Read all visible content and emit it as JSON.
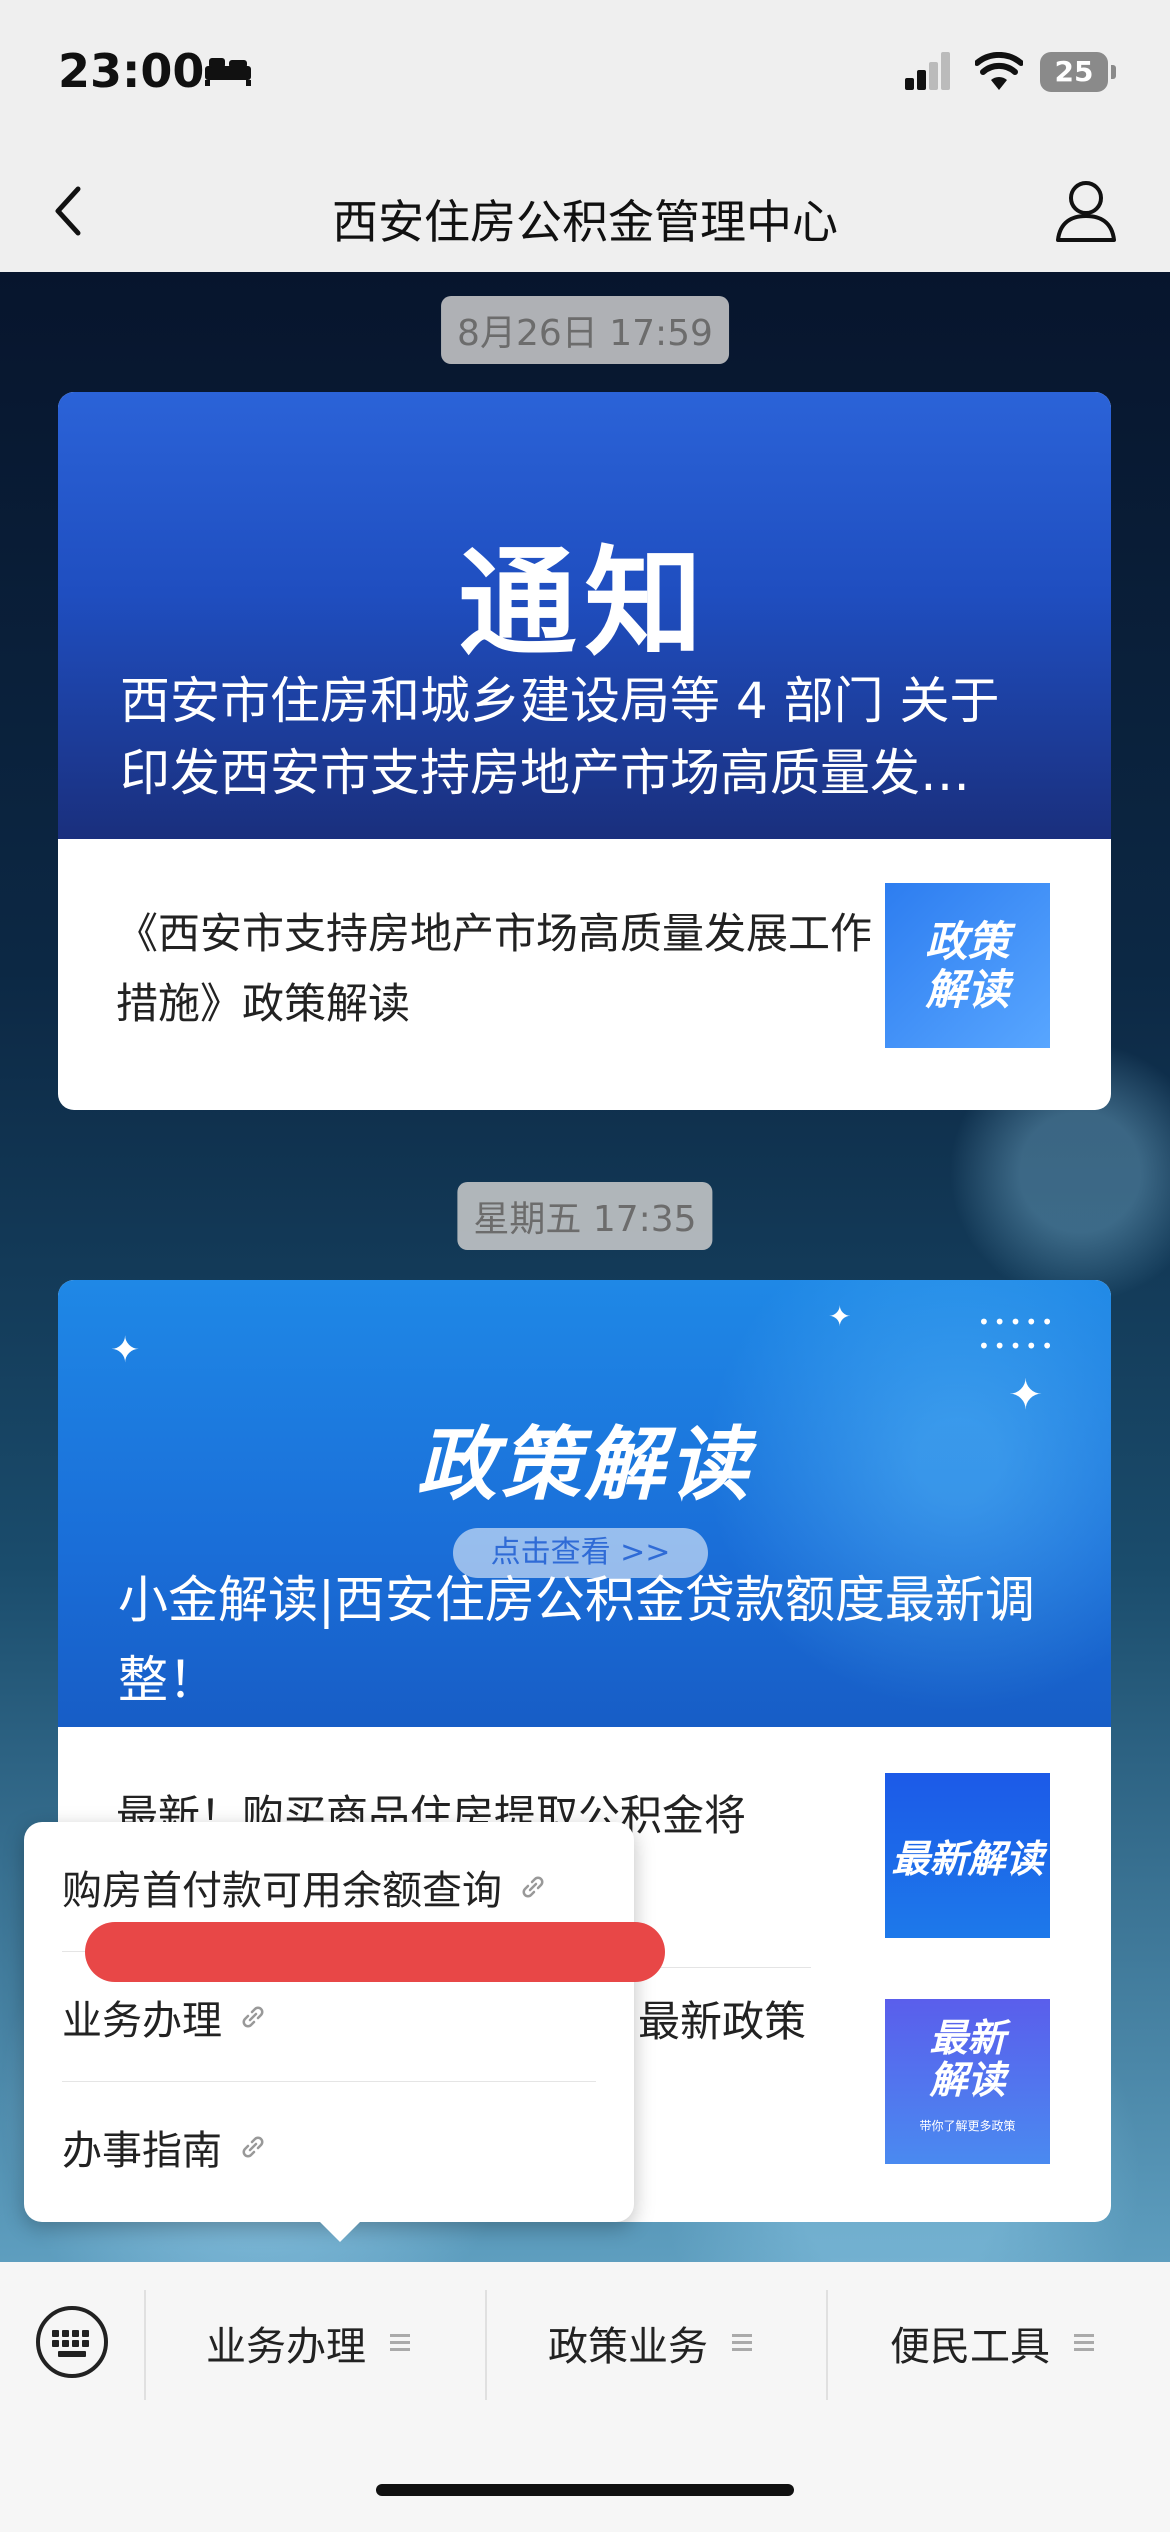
{
  "status_bar": {
    "time": "23:00",
    "battery": "25"
  },
  "nav": {
    "title": "西安住房公积金管理中心"
  },
  "messages": [
    {
      "timestamp": "8月26日 17:59",
      "hero_headline": "通知",
      "hero_caption": "西安市住房和城乡建设局等 4 部门 关于印发西安市支持房地产市场高质量发…",
      "article_title": "《西安市支持房地产市场高质量发展工作措施》政策解读",
      "thumb_label": "政策\n解读"
    },
    {
      "timestamp": "星期五 17:35",
      "hero_headline": "政策解读",
      "hero_pill": "点击查看 >>",
      "hero_caption": "小金解读|西安住房公积金贷款额度最新调整！",
      "article1_title": "最新！购买商品住房提取公积金将",
      "article1_thumb": "最新解读",
      "article2_title": "最新政策",
      "article2_thumb": "最新解读",
      "article2_thumb_sub": "带你了解更多政策"
    }
  ],
  "popup_menu": {
    "items": [
      "购房首付款可用余额查询",
      "业务办理",
      "办事指南"
    ]
  },
  "bottom_tabs": [
    "业务办理",
    "政策业务",
    "便民工具"
  ],
  "colors": {
    "nav_background": "#efefef",
    "hero1_blue": "#2b63d8",
    "hero2_blue": "#1f88e6",
    "redaction": "#e84747"
  }
}
